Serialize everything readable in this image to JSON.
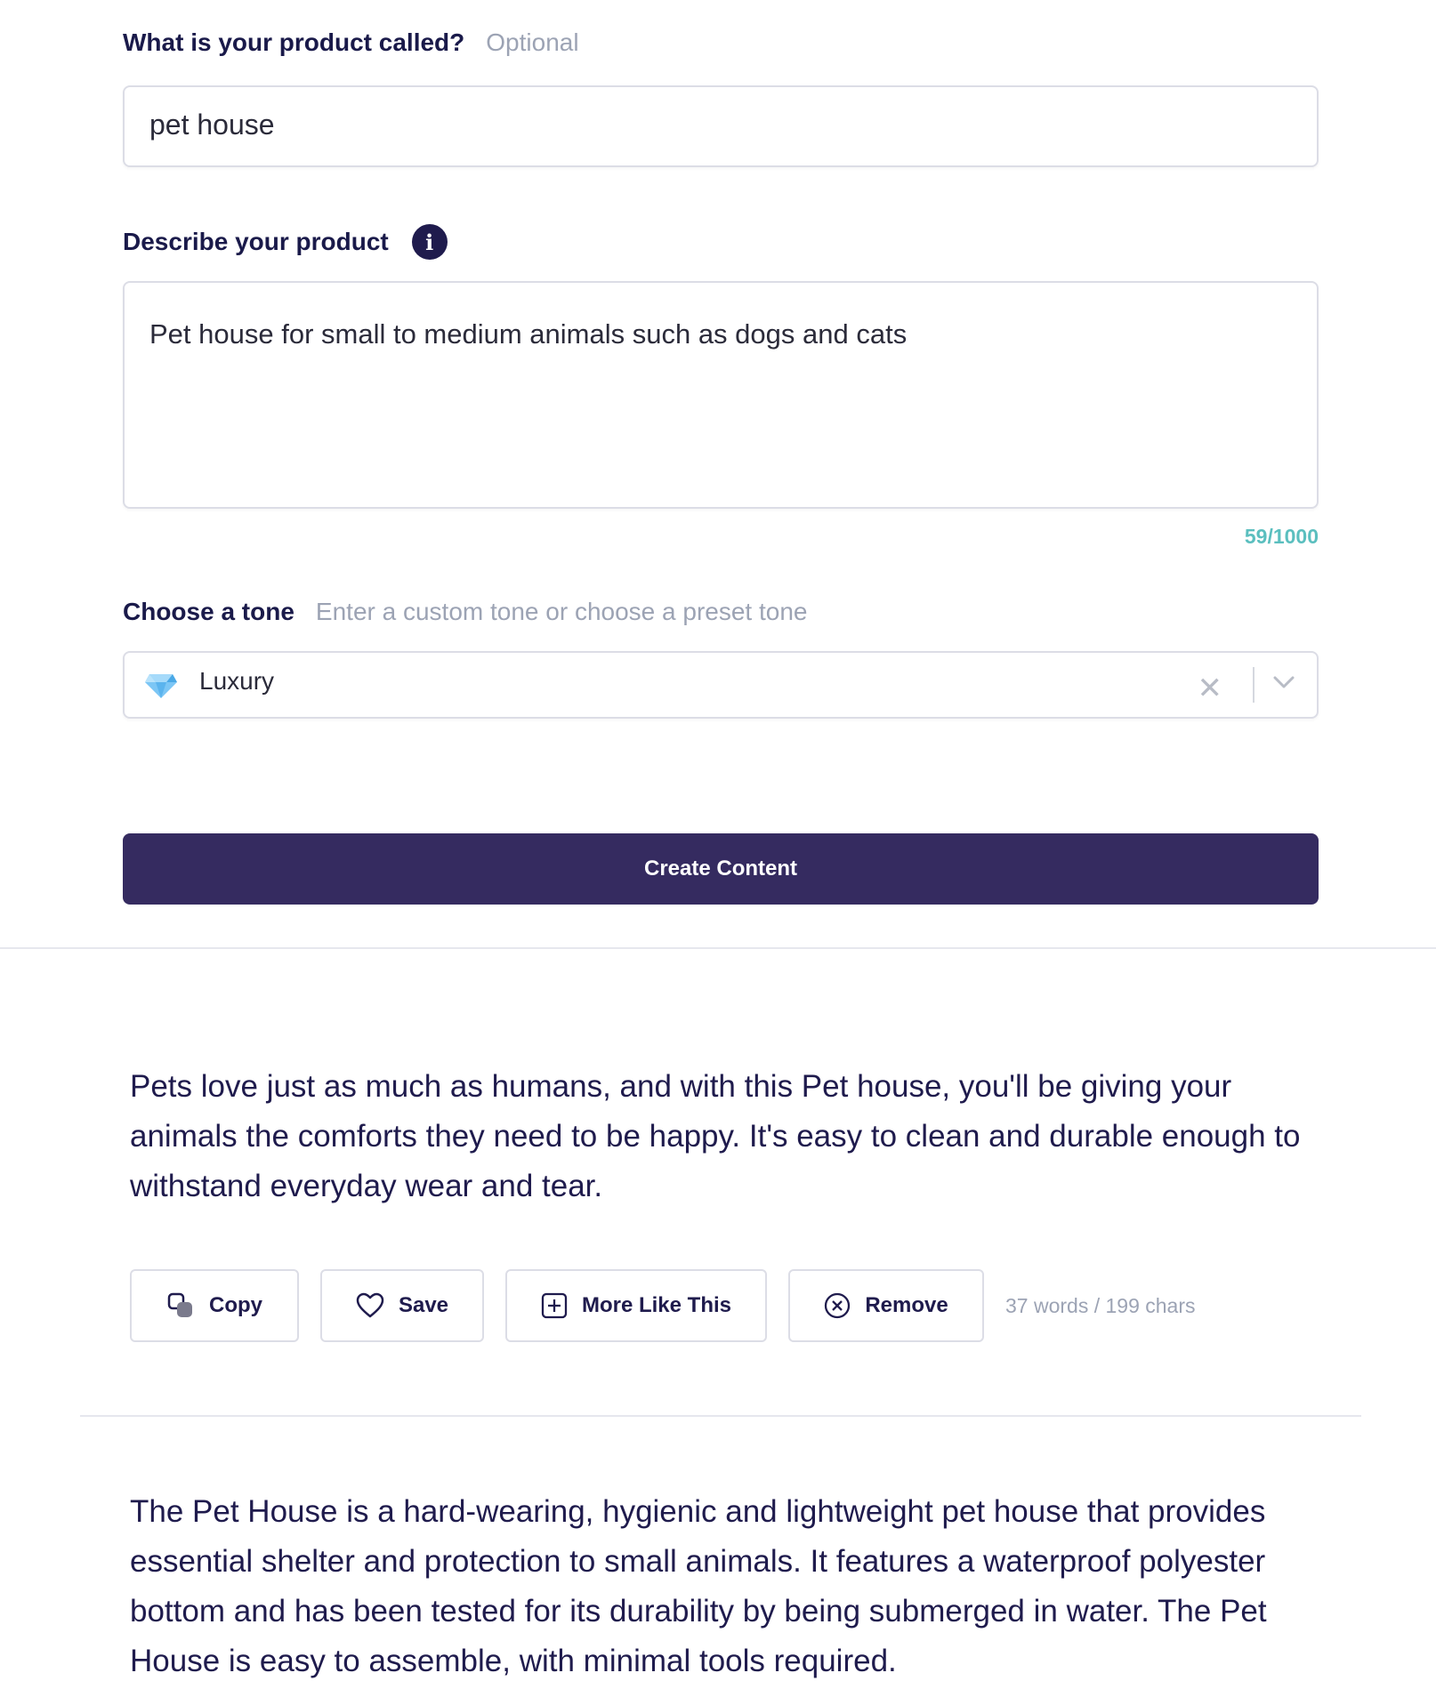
{
  "product_name": {
    "label": "What is your product called?",
    "hint": "Optional",
    "value": "pet house"
  },
  "product_description": {
    "label": "Describe your product",
    "info_icon": "info-icon",
    "value": "Pet house for small to medium animals such as dogs and cats",
    "counter": "59/1000"
  },
  "tone": {
    "label": "Choose a tone",
    "hint": "Enter a custom tone or choose a preset tone",
    "selected": "Luxury",
    "selected_icon": "gem-icon",
    "clear_icon": "close-icon",
    "dropdown_icon": "chevron-down-icon"
  },
  "create_button": {
    "label": "Create Content"
  },
  "results": [
    {
      "text": "Pets love just as much as humans, and with this Pet house, you'll be giving your animals the comforts they need to be happy. It's easy to clean and durable enough to withstand everyday wear and tear.",
      "actions": {
        "copy": "Copy",
        "save": "Save",
        "more": "More Like This",
        "remove": "Remove"
      },
      "stats": "37 words / 199 chars"
    },
    {
      "text": "The Pet House is a hard-wearing, hygienic and lightweight pet house that provides essential shelter and protection to small animals. It features a waterproof polyester bottom and has been tested for its durability by being submerged in water. The Pet House is easy to assemble, with minimal tools required."
    }
  ],
  "colors": {
    "primary": "#352b60",
    "text": "#1f1b4d",
    "muted": "#9ca3b4",
    "counter": "#5bbfbf",
    "border": "#dcdde6"
  }
}
